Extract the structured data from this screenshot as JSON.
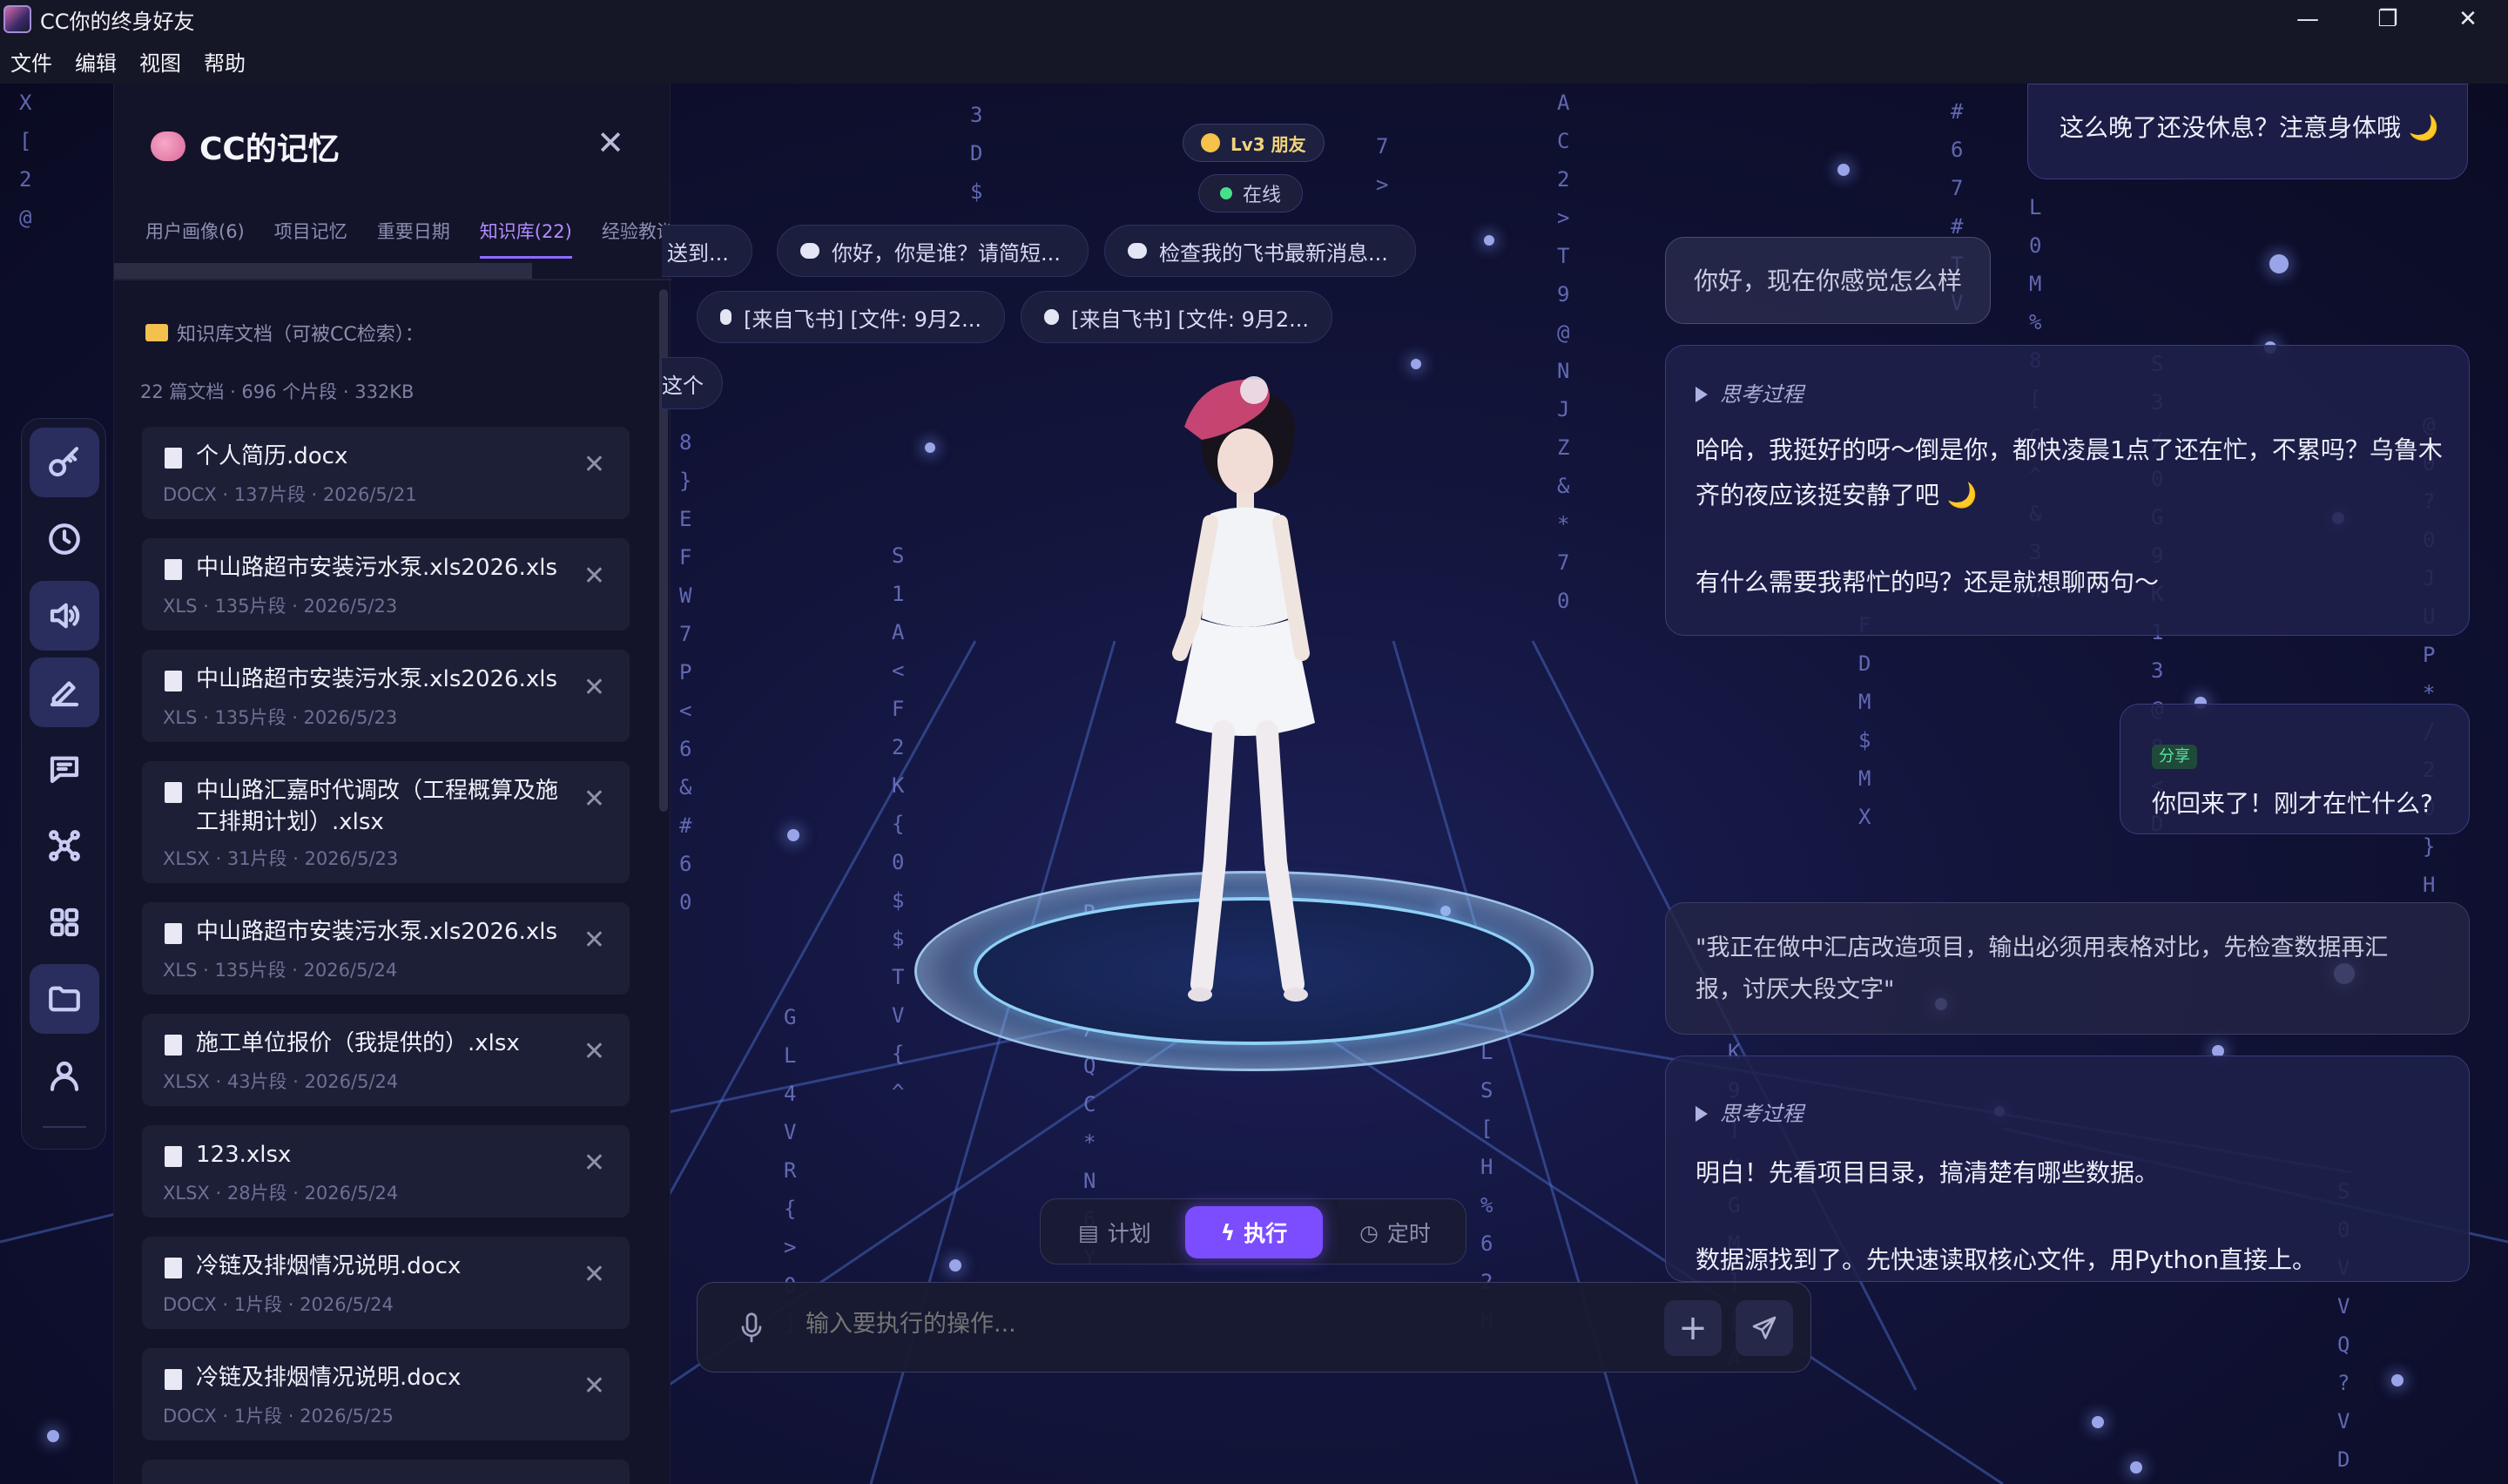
{
  "window": {
    "title": "CC你的终身好友",
    "controls": {
      "minimize": "—",
      "restore": "❐",
      "close": "✕"
    }
  },
  "menu": [
    "文件",
    "编辑",
    "视图",
    "帮助"
  ],
  "memory_panel": {
    "title": "CC的记忆",
    "close": "✕",
    "tabs": [
      "用户画像(6)",
      "项目记忆",
      "重要日期",
      "知识库(22)",
      "经验教训"
    ],
    "active_tab_index": 3,
    "folder_label": "知识库文档（可被CC检索）：",
    "stats": "22 篇文档 · 696 个片段 · 332KB",
    "documents": [
      {
        "name": "个人简历.docx",
        "meta": "DOCX · 137片段 · 2026/5/21"
      },
      {
        "name": "中山路超市安装污水泵.xls2026.xls",
        "meta": "XLS · 135片段 · 2026/5/23"
      },
      {
        "name": "中山路超市安装污水泵.xls2026.xls",
        "meta": "XLS · 135片段 · 2026/5/23"
      },
      {
        "name": "中山路汇嘉时代调改（工程概算及施工排期计划）.xlsx",
        "meta": "XLSX · 31片段 · 2026/5/23"
      },
      {
        "name": "中山路超市安装污水泵.xls2026.xls",
        "meta": "XLS · 135片段 · 2026/5/24"
      },
      {
        "name": "施工单位报价（我提供的）.xlsx",
        "meta": "XLSX · 43片段 · 2026/5/24"
      },
      {
        "name": "123.xlsx",
        "meta": "XLSX · 28片段 · 2026/5/24"
      },
      {
        "name": "冷链及排烟情况说明.docx",
        "meta": "DOCX · 1片段 · 2026/5/24"
      },
      {
        "name": "冷链及排烟情况说明.docx",
        "meta": "DOCX · 1片段 · 2026/5/25"
      }
    ]
  },
  "nav": [
    {
      "icon": "key-icon",
      "active": true
    },
    {
      "icon": "clock-icon",
      "active": false
    },
    {
      "icon": "speaker-icon",
      "active": true
    },
    {
      "icon": "pen-icon",
      "active": true
    },
    {
      "icon": "chat-icon",
      "active": false
    },
    {
      "icon": "network-icon",
      "active": false
    },
    {
      "icon": "grid-icon",
      "active": false
    },
    {
      "icon": "folder-icon",
      "active": true
    },
    {
      "icon": "user-icon",
      "active": false
    }
  ],
  "status": {
    "level": "Lv3 朋友",
    "online": "在线"
  },
  "quick_chips": {
    "row1": [
      "送到...",
      "你好，你是谁？请简短...",
      "检查我的飞书最新消息..."
    ],
    "row2": [
      "[来自飞书] [文件: 9月2...",
      "[来自飞书] [文件: 9月2..."
    ],
    "row3": [
      "这个"
    ]
  },
  "chat": {
    "msg_top": "这么晚了还没休息？注意身体哦 🌙",
    "msg_user1": "你好，现在你感觉怎么样",
    "think_label": "思考过程",
    "reply1_line1": "哈哈，我挺好的呀～倒是你，都快凌晨1点了还在忙，不累吗？乌鲁木",
    "reply1_line2": "齐的夜应该挺安静了吧 🌙",
    "reply1_line3": "有什么需要我帮忙的吗？还是就想聊两句～",
    "share_tag": "分享",
    "share_text": "你回来了！刚才在忙什么?",
    "msg_user2_line1": "\"我正在做中汇店改造项目，输出必须用表格对比，先检查数据再汇",
    "msg_user2_line2": "报，讨厌大段文字\"",
    "reply2_line1": "明白！先看项目目录，搞清楚有哪些数据。",
    "reply2_line2": "数据源找到了。先快速读取核心文件，用Python直接上。"
  },
  "modes": {
    "plan": "计划",
    "execute": "执行",
    "schedule": "定时",
    "active": "execute"
  },
  "input": {
    "placeholder": "输入要执行的操作..."
  },
  "colors": {
    "accent": "#7b4dff",
    "tab_active": "#b38cff",
    "background": "#0b0d22"
  }
}
